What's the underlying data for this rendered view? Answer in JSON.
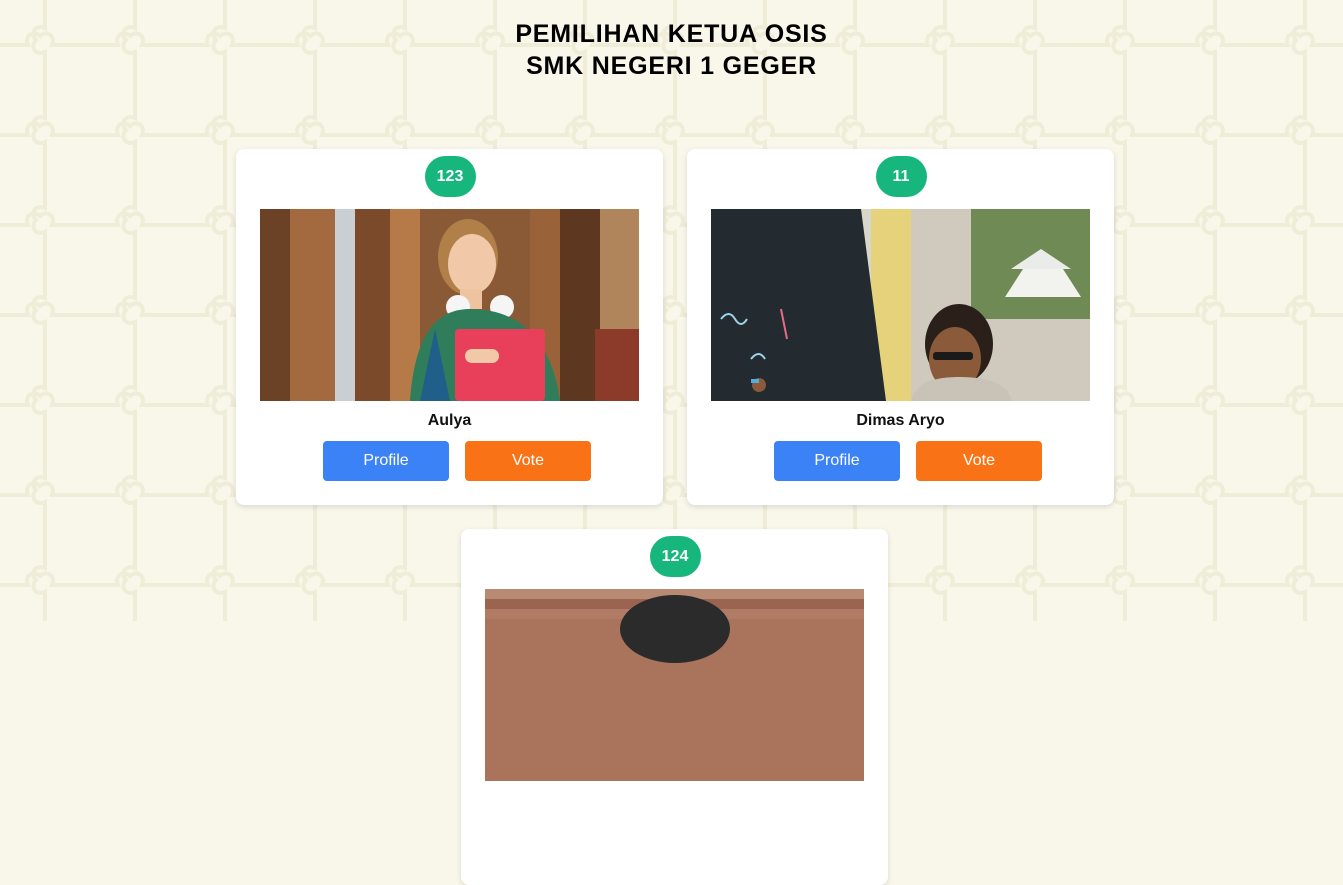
{
  "header": {
    "title_line1": "PEMILIHAN KETUA OSIS",
    "title_line2": "SMK NEGERI 1 GEGER"
  },
  "candidates": [
    {
      "number": "123",
      "name": "Aulya",
      "profile_label": "Profile",
      "vote_label": "Vote"
    },
    {
      "number": "11",
      "name": "Dimas Aryo",
      "profile_label": "Profile",
      "vote_label": "Vote"
    },
    {
      "number": "124"
    }
  ],
  "colors": {
    "background": "#f9f7ea",
    "badge": "#16b67c",
    "profile_button": "#3b82f6",
    "vote_button": "#f97316"
  }
}
